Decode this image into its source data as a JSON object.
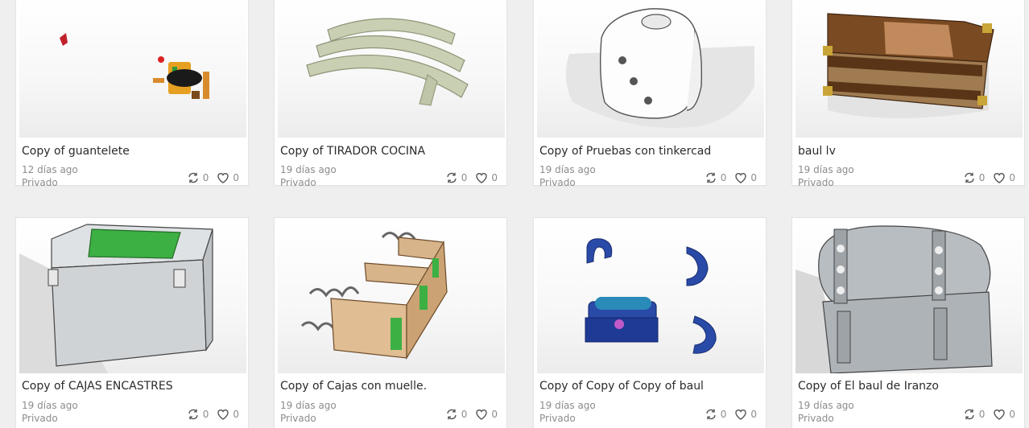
{
  "cards": [
    {
      "title": "Copy of guantelete",
      "date": "12 días ago",
      "privacy": "Privado",
      "remixes": "0",
      "likes": "0"
    },
    {
      "title": "Copy of TIRADOR COCINA",
      "date": "19 días ago",
      "privacy": "Privado",
      "remixes": "0",
      "likes": "0"
    },
    {
      "title": "Copy of Pruebas con tinkercad",
      "date": "19 días ago",
      "privacy": "Privado",
      "remixes": "0",
      "likes": "0"
    },
    {
      "title": "baul lv",
      "date": "19 días ago",
      "privacy": "Privado",
      "remixes": "0",
      "likes": "0"
    },
    {
      "title": "Copy of CAJAS ENCASTRES",
      "date": "19 días ago",
      "privacy": "Privado",
      "remixes": "0",
      "likes": "0"
    },
    {
      "title": "Copy of Cajas con muelle.",
      "date": "19 días ago",
      "privacy": "Privado",
      "remixes": "0",
      "likes": "0"
    },
    {
      "title": "Copy of Copy of Copy of baul",
      "date": "19 días ago",
      "privacy": "Privado",
      "remixes": "0",
      "likes": "0"
    },
    {
      "title": "Copy of El baul de Iranzo",
      "date": "19 días ago",
      "privacy": "Privado",
      "remixes": "0",
      "likes": "0"
    }
  ],
  "icons": {
    "remix": "remix-icon",
    "like": "heart-icon"
  },
  "colors": {
    "background": "#efefef",
    "card": "#ffffff",
    "title": "#2b2b2b",
    "meta": "#8c8c8c"
  }
}
